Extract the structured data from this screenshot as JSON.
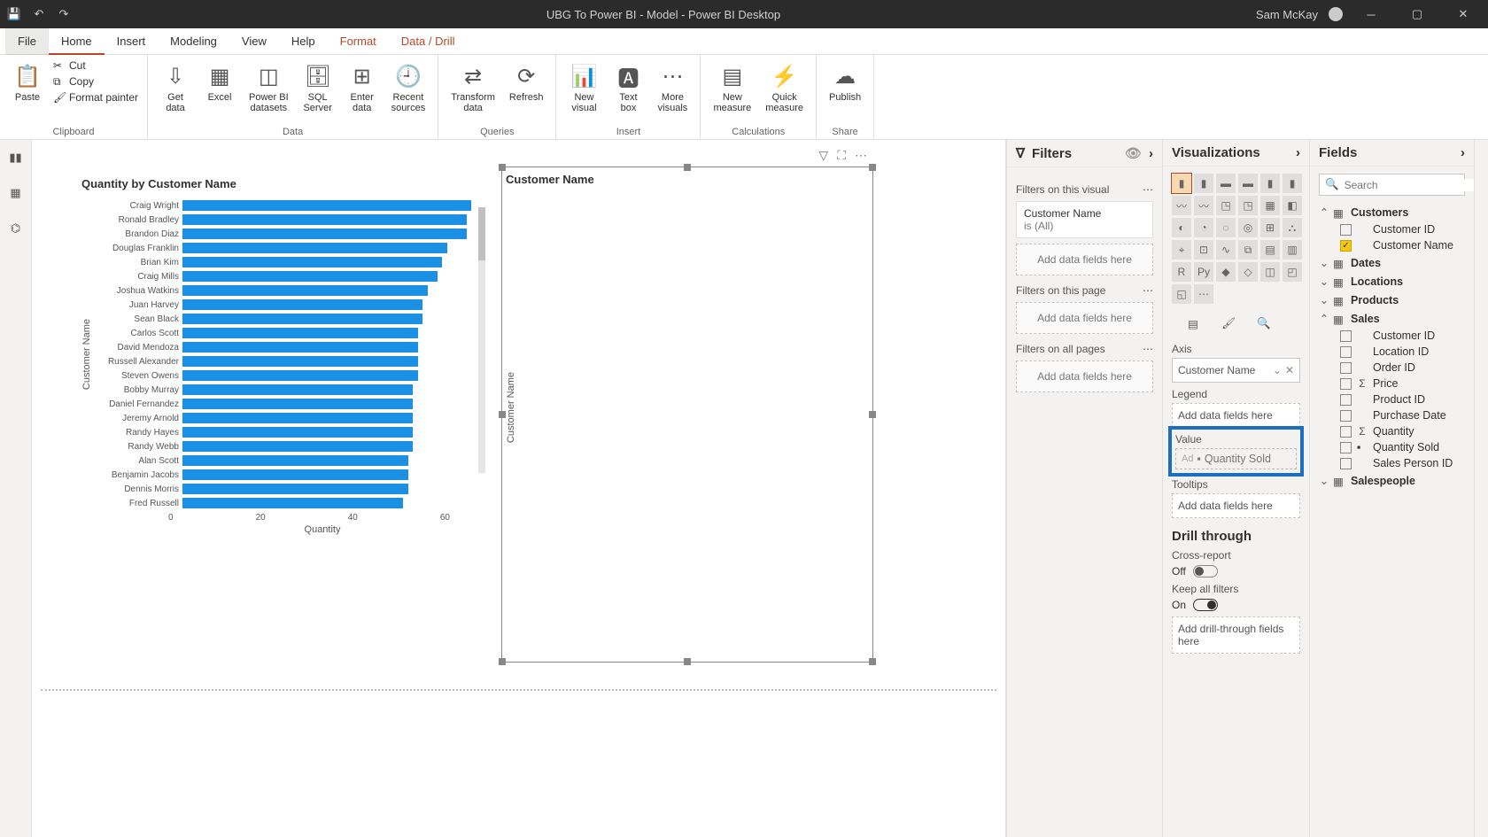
{
  "titlebar": {
    "title": "UBG To Power BI - Model - Power BI Desktop",
    "user": "Sam McKay"
  },
  "ribbon": {
    "tabs": [
      "File",
      "Home",
      "Insert",
      "Modeling",
      "View",
      "Help",
      "Format",
      "Data / Drill"
    ],
    "active": "Home",
    "clipboard": {
      "paste": "Paste",
      "cut": "Cut",
      "copy": "Copy",
      "format_painter": "Format painter",
      "label": "Clipboard"
    },
    "data": {
      "get_data": "Get\ndata",
      "pbi_datasets": "Power BI\ndatasets",
      "excel": "Excel",
      "sql": "SQL\nServer",
      "enter": "Enter\ndata",
      "recent": "Recent\nsources",
      "label": "Data"
    },
    "queries": {
      "transform": "Transform\ndata",
      "refresh": "Refresh",
      "label": "Queries"
    },
    "insert": {
      "new_visual": "New\nvisual",
      "text_box": "Text\nbox",
      "more_visuals": "More\nvisuals",
      "label": "Insert"
    },
    "calculations": {
      "new_measure": "New\nmeasure",
      "quick_measure": "Quick\nmeasure",
      "label": "Calculations"
    },
    "share": {
      "publish": "Publish",
      "label": "Share"
    }
  },
  "filters": {
    "header": "Filters",
    "on_visual": "Filters on this visual",
    "card_name": "Customer Name",
    "card_state": "is (All)",
    "add": "Add data fields here",
    "on_page": "Filters on this page",
    "on_all": "Filters on all pages"
  },
  "viz": {
    "header": "Visualizations",
    "axis": "Axis",
    "axis_field": "Customer Name",
    "legend": "Legend",
    "add": "Add data fields here",
    "value": "Value",
    "value_drag": "Quantity Sold",
    "tooltips": "Tooltips",
    "drill": "Drill through",
    "cross": "Cross-report",
    "off": "Off",
    "keep": "Keep all filters",
    "on": "On",
    "add_drill": "Add drill-through fields here"
  },
  "fields": {
    "header": "Fields",
    "search_placeholder": "Search",
    "tables": [
      {
        "name": "Customers",
        "expanded": true,
        "fields": [
          {
            "name": "Customer ID",
            "checked": false
          },
          {
            "name": "Customer Name",
            "checked": true
          }
        ]
      },
      {
        "name": "Dates",
        "expanded": false
      },
      {
        "name": "Locations",
        "expanded": false
      },
      {
        "name": "Products",
        "expanded": false
      },
      {
        "name": "Sales",
        "expanded": true,
        "fields": [
          {
            "name": "Customer ID"
          },
          {
            "name": "Location ID"
          },
          {
            "name": "Order ID"
          },
          {
            "name": "Price",
            "sigma": true
          },
          {
            "name": "Product ID"
          },
          {
            "name": "Purchase Date"
          },
          {
            "name": "Quantity",
            "sigma": true
          },
          {
            "name": "Quantity Sold",
            "db": true
          },
          {
            "name": "Sales Person ID"
          }
        ]
      },
      {
        "name": "Salespeople",
        "expanded": false
      }
    ]
  },
  "chart_data": {
    "type": "bar",
    "title": "Quantity by Customer Name",
    "xlabel": "Quantity",
    "ylabel": "Customer Name",
    "xlim": [
      0,
      60
    ],
    "xticks": [
      0,
      20,
      40,
      60
    ],
    "categories": [
      "Craig Wright",
      "Ronald Bradley",
      "Brandon Diaz",
      "Douglas Franklin",
      "Brian Kim",
      "Craig Mills",
      "Joshua Watkins",
      "Juan Harvey",
      "Sean Black",
      "Carlos Scott",
      "David Mendoza",
      "Russell Alexander",
      "Steven Owens",
      "Bobby Murray",
      "Daniel Fernandez",
      "Jeremy Arnold",
      "Randy Hayes",
      "Randy Webb",
      "Alan Scott",
      "Benjamin Jacobs",
      "Dennis Morris",
      "Fred Russell"
    ],
    "values": [
      59,
      58,
      58,
      54,
      53,
      52,
      50,
      49,
      49,
      48,
      48,
      48,
      48,
      47,
      47,
      47,
      47,
      47,
      46,
      46,
      46,
      45
    ]
  },
  "visual2": {
    "title": "Customer Name",
    "ylabel": "Customer Name"
  }
}
